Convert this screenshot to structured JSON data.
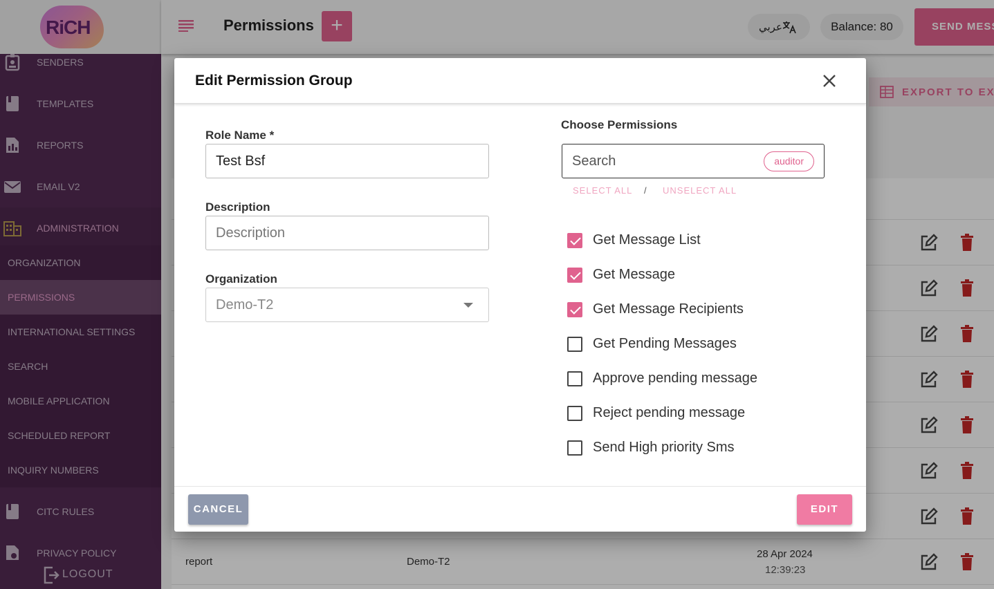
{
  "app": {
    "logo_text": "RiCH",
    "page_title": "Permissions",
    "add_label": "+",
    "language_label": "عربي",
    "balance": "Balance: 80",
    "send_label": "SEND MESSAGE",
    "export_label": "EXPORT TO EXCEL"
  },
  "sidebar": {
    "items": [
      {
        "label": "SENDERS",
        "icon": "badge-icon"
      },
      {
        "label": "TEMPLATES",
        "icon": "book-icon"
      },
      {
        "label": "REPORTS",
        "icon": "report-icon"
      },
      {
        "label": "EMAIL V2",
        "icon": "mail-icon"
      },
      {
        "label": "ADMINISTRATION",
        "icon": "building-icon"
      }
    ],
    "sub_items": [
      {
        "label": "ORGANIZATION"
      },
      {
        "label": "PERMISSIONS",
        "active": true
      },
      {
        "label": "INTERNATIONAL SETTINGS"
      },
      {
        "label": "SEARCH"
      },
      {
        "label": "MOBILE APPLICATION"
      },
      {
        "label": "SCHEDULED REPORT"
      },
      {
        "label": "INQUIRY NUMBERS"
      }
    ],
    "bottom_items": [
      {
        "label": "CITC RULES",
        "icon": "book-icon"
      },
      {
        "label": "PRIVACY POLICY",
        "icon": "document-icon"
      }
    ],
    "logout_label": "LOGOUT"
  },
  "table": {
    "last_row": {
      "name": "report",
      "organization": "Demo-T2",
      "date": "28 Apr 2024",
      "time": "12:39:23"
    }
  },
  "modal": {
    "title": "Edit Permission Group",
    "role_name_label": "Role Name *",
    "role_name_value": "Test Bsf",
    "description_label": "Description",
    "description_placeholder": "Description",
    "organization_label": "Organization",
    "organization_value": "Demo-T2",
    "choose_permissions_label": "Choose Permissions",
    "search_placeholder": "Search",
    "search_chip": "auditor",
    "select_all": "SELECT ALL",
    "separator": "/",
    "unselect_all": "UNSELECT ALL",
    "permissions": [
      {
        "label": "Get Message List",
        "checked": true
      },
      {
        "label": "Get Message",
        "checked": true
      },
      {
        "label": "Get Message Recipients",
        "checked": true
      },
      {
        "label": "Get Pending Messages",
        "checked": false
      },
      {
        "label": "Approve pending message",
        "checked": false
      },
      {
        "label": "Reject pending message",
        "checked": false
      },
      {
        "label": "Send High priority Sms",
        "checked": false
      }
    ],
    "cancel_label": "CANCEL",
    "edit_label": "EDIT"
  },
  "colors": {
    "accent": "#e0628e",
    "sidebar": "#552c55",
    "delete": "#c62828"
  }
}
